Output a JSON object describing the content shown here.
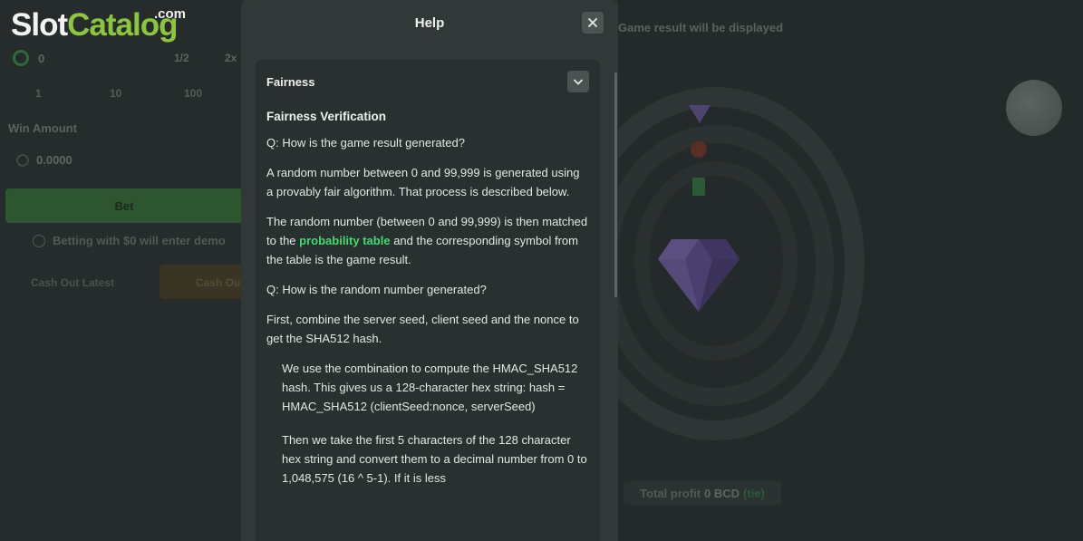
{
  "watermark": {
    "slot": "Slot",
    "catalog": "Catalog",
    "dotcom": ".com"
  },
  "background": {
    "bet_amount": "0",
    "half_label": "1/2",
    "double_label": "2x",
    "quick_amounts": [
      "1",
      "10",
      "100"
    ],
    "win_amount_label": "Win Amount",
    "win_amount_value": "0.0000",
    "bet_button": "Bet",
    "demo_note": "Betting with $0 will enter demo",
    "cash_out_latest": "Cash Out Latest",
    "cash_out_button": "Cash Ou",
    "result_placeholder": "Game result will be displayed",
    "profit": {
      "label": "Total profit",
      "value": "0 BCD",
      "tie": "(tie)"
    }
  },
  "modal": {
    "title": "Help",
    "close_icon": "close-icon",
    "section": {
      "title": "Fairness",
      "toggle_icon": "chevron-down-icon",
      "subtitle": "Fairness Verification",
      "q1": "Q: How is the game result generated?",
      "p1": "A random number between 0 and 99,999 is generated using a provably fair algorithm. That process is described below.",
      "p2_before": "The random number (between 0 and 99,999) is then matched to the",
      "p2_link": "probability table",
      "p2_after": "and the corresponding symbol from the table is the game result.",
      "q2": "Q: How is the random number generated?",
      "p3": "First, combine the server seed, client seed and the nonce to get the SHA512 hash.",
      "p4": "We use the combination to compute the HMAC_SHA512 hash. This gives us a 128-character hex string: hash = HMAC_SHA512 (clientSeed:nonce, serverSeed)",
      "p5": "Then we take the first 5 characters of the 128 character hex string and convert them to a decimal number from 0 to 1,048,575 (16 ^ 5-1). If it is less"
    }
  },
  "colors": {
    "accent_link": "#3fdc6e",
    "modal_bg": "#313938",
    "card_bg": "#283030"
  }
}
